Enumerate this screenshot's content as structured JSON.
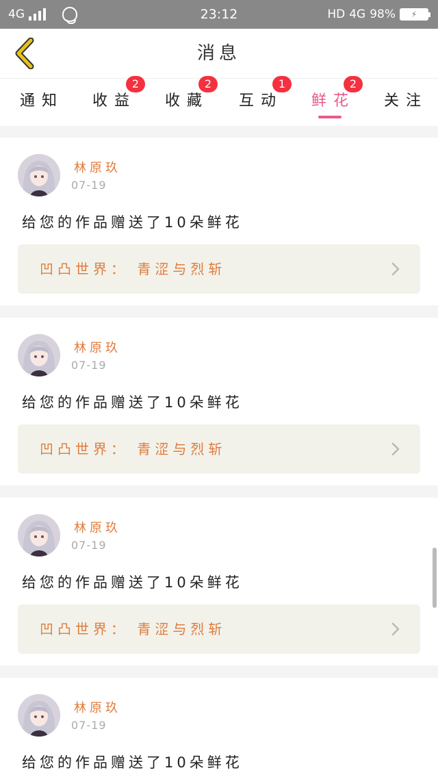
{
  "status_bar": {
    "network_left": "4G",
    "time": "23:12",
    "hd": "HD",
    "network_right": "4G",
    "battery": "98%",
    "icons": [
      "signal-icon",
      "qq-icon",
      "battery-icon"
    ]
  },
  "header": {
    "title": "消息",
    "back_icon": "chevron-left-icon",
    "accent": "#e6c21a"
  },
  "tabs": [
    {
      "label": "通知",
      "badge": null
    },
    {
      "label": "收益",
      "badge": "2"
    },
    {
      "label": "收藏",
      "badge": "2"
    },
    {
      "label": "互动",
      "badge": "1"
    },
    {
      "label": "鲜花",
      "badge": "2",
      "active": true
    },
    {
      "label": "关注",
      "badge": null
    }
  ],
  "colors": {
    "active_tab": "#e85a8a",
    "badge": "#f5303f",
    "username": "#e07b3c",
    "link_bg": "#f2f2ea"
  },
  "messages": [
    {
      "user": "林原玖",
      "date": "07-19",
      "text": "给您的作品赠送了10朵鲜花",
      "work": "凹凸世界：  青涩与烈斩"
    },
    {
      "user": "林原玖",
      "date": "07-19",
      "text": "给您的作品赠送了10朵鲜花",
      "work": "凹凸世界：  青涩与烈斩"
    },
    {
      "user": "林原玖",
      "date": "07-19",
      "text": "给您的作品赠送了10朵鲜花",
      "work": "凹凸世界：  青涩与烈斩"
    },
    {
      "user": "林原玖",
      "date": "07-19",
      "text": "给您的作品赠送了10朵鲜花",
      "work": ""
    }
  ]
}
